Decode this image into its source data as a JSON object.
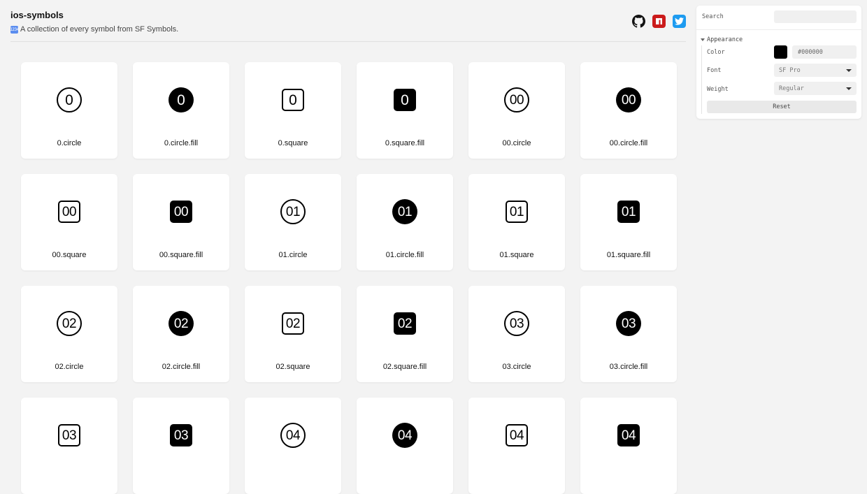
{
  "header": {
    "title": "ios-symbols",
    "subtitle_emoji": "1234",
    "subtitle": "A collection of every symbol from SF Symbols."
  },
  "social": {
    "github": "github-icon",
    "npm": "npm-icon",
    "twitter": "twitter-icon"
  },
  "symbols": [
    {
      "glyph": "0",
      "style": "circle",
      "name": "0.circle"
    },
    {
      "glyph": "0",
      "style": "circle-fill",
      "name": "0.circle.fill"
    },
    {
      "glyph": "0",
      "style": "square",
      "name": "0.square"
    },
    {
      "glyph": "0",
      "style": "square-fill",
      "name": "0.square.fill"
    },
    {
      "glyph": "00",
      "style": "circle",
      "name": "00.circle"
    },
    {
      "glyph": "00",
      "style": "circle-fill",
      "name": "00.circle.fill"
    },
    {
      "glyph": "00",
      "style": "square",
      "name": "00.square"
    },
    {
      "glyph": "00",
      "style": "square-fill",
      "name": "00.square.fill"
    },
    {
      "glyph": "01",
      "style": "circle",
      "name": "01.circle"
    },
    {
      "glyph": "01",
      "style": "circle-fill",
      "name": "01.circle.fill"
    },
    {
      "glyph": "01",
      "style": "square",
      "name": "01.square"
    },
    {
      "glyph": "01",
      "style": "square-fill",
      "name": "01.square.fill"
    },
    {
      "glyph": "02",
      "style": "circle",
      "name": "02.circle"
    },
    {
      "glyph": "02",
      "style": "circle-fill",
      "name": "02.circle.fill"
    },
    {
      "glyph": "02",
      "style": "square",
      "name": "02.square"
    },
    {
      "glyph": "02",
      "style": "square-fill",
      "name": "02.square.fill"
    },
    {
      "glyph": "03",
      "style": "circle",
      "name": "03.circle"
    },
    {
      "glyph": "03",
      "style": "circle-fill",
      "name": "03.circle.fill"
    },
    {
      "glyph": "03",
      "style": "square",
      "name": ""
    },
    {
      "glyph": "03",
      "style": "square-fill",
      "name": ""
    },
    {
      "glyph": "04",
      "style": "circle",
      "name": ""
    },
    {
      "glyph": "04",
      "style": "circle-fill",
      "name": ""
    },
    {
      "glyph": "04",
      "style": "square",
      "name": ""
    },
    {
      "glyph": "04",
      "style": "square-fill",
      "name": ""
    }
  ],
  "panel": {
    "search_label": "Search",
    "search_value": "",
    "folder_label": "Appearance",
    "color_label": "Color",
    "color_value": "#000000",
    "font_label": "Font",
    "font_value": "SF Pro",
    "weight_label": "Weight",
    "weight_value": "Regular",
    "reset_label": "Reset"
  },
  "colors": {
    "background": "#f3f3f3",
    "card": "#ffffff",
    "symbol": "#000000",
    "npm": "#cb1b1b",
    "twitter": "#1d9bf0"
  }
}
